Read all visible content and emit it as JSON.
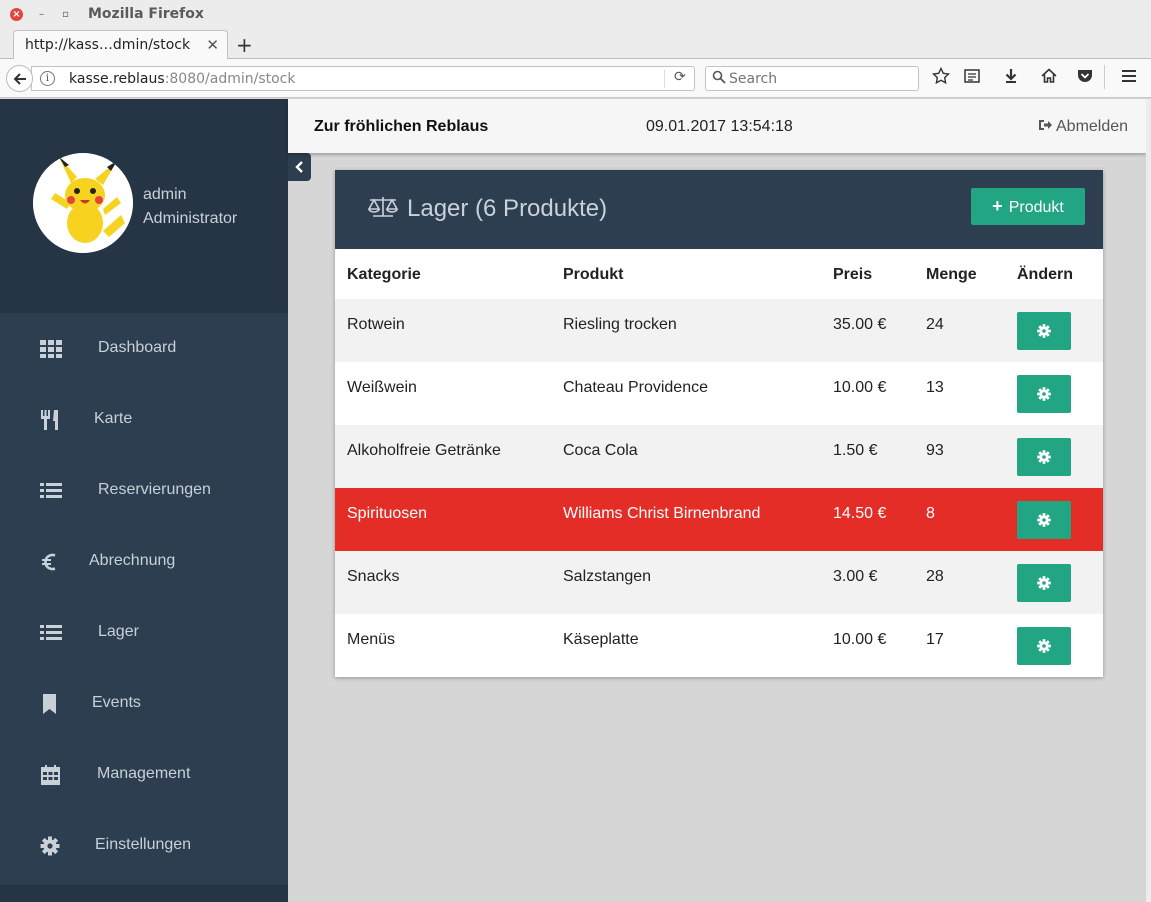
{
  "browser": {
    "window_title": "Mozilla Firefox",
    "tab_title": "http://kass…dmin/stock",
    "url_host": "kasse.reblaus",
    "url_rest": ":8080/admin/stock",
    "search_placeholder": "Search"
  },
  "user": {
    "name": "admin",
    "role": "Administrator"
  },
  "sidebar": {
    "items": [
      {
        "label": "Dashboard",
        "icon": "grid-icon"
      },
      {
        "label": "Karte",
        "icon": "cutlery-icon"
      },
      {
        "label": "Reservierungen",
        "icon": "list-icon"
      },
      {
        "label": "Abrechnung",
        "icon": "euro-icon"
      },
      {
        "label": "Lager",
        "icon": "list-icon"
      },
      {
        "label": "Events",
        "icon": "bookmark-icon"
      },
      {
        "label": "Management",
        "icon": "calendar-icon"
      },
      {
        "label": "Einstellungen",
        "icon": "gear-icon"
      }
    ]
  },
  "topbar": {
    "shop_name": "Zur fröhlichen Reblaus",
    "datetime": "09.01.2017 13:54:18",
    "logout_label": "Abmelden"
  },
  "stock": {
    "title": "Lager (6 Produkte)",
    "add_label": "Produkt",
    "columns": [
      "Kategorie",
      "Produkt",
      "Preis",
      "Menge",
      "Ändern"
    ],
    "rows": [
      {
        "kategorie": "Rotwein",
        "produkt": "Riesling trocken",
        "preis": "35.00 €",
        "menge": "24",
        "low": false
      },
      {
        "kategorie": "Weißwein",
        "produkt": "Chateau Providence",
        "preis": "10.00 €",
        "menge": "13",
        "low": false
      },
      {
        "kategorie": "Alkoholfreie Getränke",
        "produkt": "Coca Cola",
        "preis": "1.50 €",
        "menge": "93",
        "low": false
      },
      {
        "kategorie": "Spirituosen",
        "produkt": "Williams Christ Birnenbrand",
        "preis": "14.50 €",
        "menge": "8",
        "low": true
      },
      {
        "kategorie": "Snacks",
        "produkt": "Salzstangen",
        "preis": "3.00 €",
        "menge": "28",
        "low": false
      },
      {
        "kategorie": "Menüs",
        "produkt": "Käseplatte",
        "preis": "10.00 €",
        "menge": "17",
        "low": false
      }
    ]
  },
  "colors": {
    "sidebar_bg": "#2d3e50",
    "accent_green": "#21a583",
    "alert_red": "#e42d27"
  }
}
